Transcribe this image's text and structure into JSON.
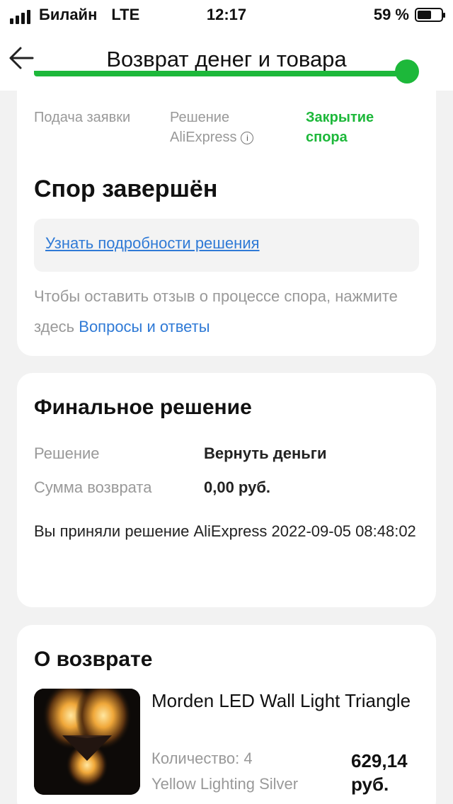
{
  "status_bar": {
    "carrier": "Билайн",
    "network": "LTE",
    "time": "12:17",
    "battery_percent": "59 %",
    "battery_level": 0.59
  },
  "header": {
    "title": "Возврат денег и товара",
    "back_icon": "arrow-left-icon"
  },
  "progress": {
    "completed_fraction": 1.0,
    "color": "#1db83a",
    "steps": [
      {
        "line1": "Подача заявки",
        "line2": ""
      },
      {
        "line1": "Решение",
        "line2": "AliExpress",
        "info_icon": "info-icon"
      },
      {
        "line1": "Закрытие",
        "line2": "спора",
        "active": true
      }
    ]
  },
  "dispute": {
    "title": "Спор завершён",
    "details_link": "Узнать подробности решения",
    "feedback_text": "Чтобы оставить отзыв о процессе спора, нажмите здесь",
    "feedback_link": "Вопросы и ответы"
  },
  "final_decision": {
    "title": "Финальное решение",
    "rows": [
      {
        "label": "Решение",
        "value": "Вернуть деньги"
      },
      {
        "label": "Сумма возврата",
        "value": "0,00 руб."
      }
    ],
    "note": "Вы приняли решение AliExpress 2022-09-05 08:48:02"
  },
  "return_info": {
    "title": "О возврате",
    "product": {
      "name": "Morden LED Wall Light Triangle",
      "quantity": "Количество: 4",
      "variant": "Yellow Lighting Silver",
      "price": "629,14 руб."
    }
  },
  "colors": {
    "accent_green": "#1db83a",
    "link_blue": "#2f7ad6",
    "muted_text": "#999999",
    "background": "#f2f2f2"
  }
}
